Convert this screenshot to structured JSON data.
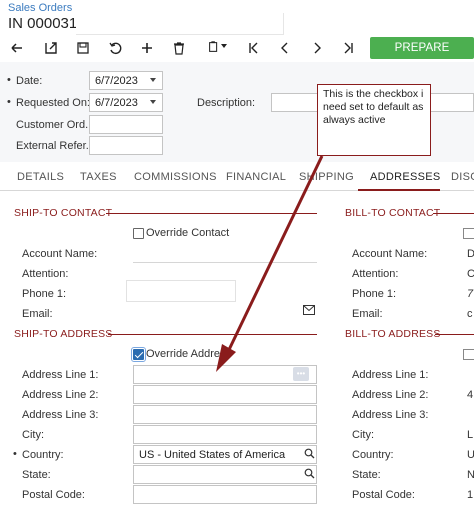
{
  "header": {
    "breadcrumb": "Sales Orders",
    "title": "IN 000031 -"
  },
  "toolbar": {
    "icons": [
      "undo-arrow-icon",
      "save-close-icon",
      "save-icon",
      "cancel-icon",
      "add-icon",
      "delete-icon",
      "copy-paste-icon",
      "first-icon",
      "previous-icon",
      "next-icon",
      "last-icon"
    ],
    "primary_action": "PREPARE INVOICE"
  },
  "form": {
    "date_label": "Date:",
    "date_value": "6/7/2023",
    "requested_on_label": "Requested On:",
    "requested_on_value": "6/7/2023",
    "customer_order_label": "Customer Ord...",
    "customer_order_value": "",
    "external_ref_label": "External Refer...",
    "external_ref_value": "",
    "description_label": "Description:",
    "description_value": ""
  },
  "tabs": [
    "DETAILS",
    "TAXES",
    "COMMISSIONS",
    "FINANCIAL",
    "SHIPPING",
    "ADDRESSES",
    "DISC"
  ],
  "active_tab": "ADDRESSES",
  "ship_to_contact": {
    "title": "SHIP-TO CONTACT",
    "override_label": "Override Contact",
    "override_checked": false,
    "account_name_label": "Account Name:",
    "attention_label": "Attention:",
    "phone1_label": "Phone 1:",
    "email_label": "Email:"
  },
  "ship_to_address": {
    "title": "SHIP-TO ADDRESS",
    "override_label": "Override Address",
    "override_checked": true,
    "line1_label": "Address Line 1:",
    "line2_label": "Address Line 2:",
    "line3_label": "Address Line 3:",
    "city_label": "City:",
    "country_label": "Country:",
    "country_value": "US - United States of America",
    "state_label": "State:",
    "postal_label": "Postal Code:",
    "more_button": "•••"
  },
  "bill_to_contact": {
    "title": "BILL-TO CONTACT",
    "account_name_label": "Account Name:",
    "attention_label": "Attention:",
    "phone1_label": "Phone 1:",
    "email_label": "Email:",
    "account_name_value": "D",
    "attention_value": "C",
    "phone1_value": "7",
    "email_value": "c"
  },
  "bill_to_address": {
    "title": "BILL-TO ADDRESS",
    "line1_label": "Address Line 1:",
    "line2_label": "Address Line 2:",
    "line3_label": "Address Line 3:",
    "city_label": "City:",
    "country_label": "Country:",
    "state_label": "State:",
    "postal_label": "Postal Code:",
    "line2_value": "4",
    "city_value": "L",
    "country_value": "U",
    "state_value": "N",
    "postal_value": "1"
  },
  "callout": {
    "text": "This is the checkbox i need set to default as always active"
  },
  "colors": {
    "accent_red": "#8a1c1c",
    "primary_green": "#4caf50",
    "link_blue": "#3b7bbf",
    "checkbox_blue": "#2b6cb0"
  }
}
